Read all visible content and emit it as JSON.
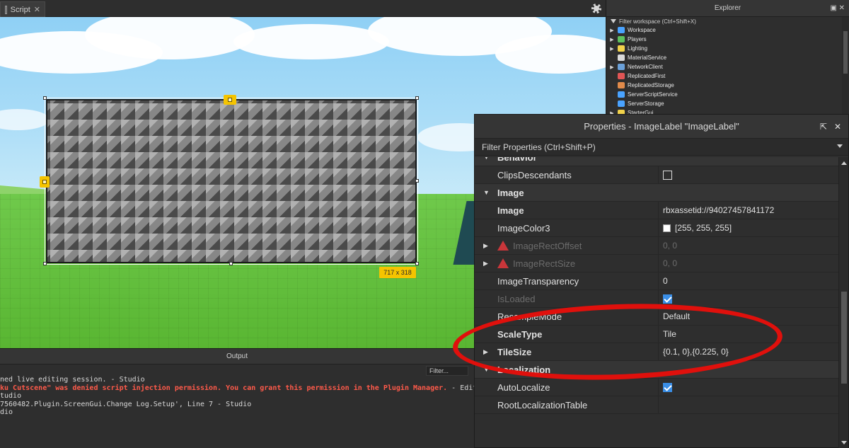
{
  "tabs": [
    {
      "label": "Script",
      "close": "✕"
    }
  ],
  "viewport": {
    "size_label": "717 x 318"
  },
  "explorer": {
    "title": "Explorer",
    "filter_placeholder": "Filter workspace (Ctrl+Shift+X)",
    "items": [
      {
        "label": "Workspace",
        "expandable": true,
        "icon_color": "#4aa3ff",
        "icon": "workspace-icon"
      },
      {
        "label": "Players",
        "expandable": true,
        "icon_color": "#5ec15e",
        "icon": "players-icon"
      },
      {
        "label": "Lighting",
        "expandable": true,
        "icon_color": "#f1d24b",
        "icon": "lighting-icon"
      },
      {
        "label": "MaterialService",
        "expandable": false,
        "icon_color": "#d9d9d9",
        "icon": "material-service-icon"
      },
      {
        "label": "NetworkClient",
        "expandable": true,
        "icon_color": "#6aa0d8",
        "icon": "network-client-icon"
      },
      {
        "label": "ReplicatedFirst",
        "expandable": false,
        "icon_color": "#e05555",
        "icon": "replicated-first-icon"
      },
      {
        "label": "ReplicatedStorage",
        "expandable": false,
        "icon_color": "#e08a4a",
        "icon": "replicated-storage-icon"
      },
      {
        "label": "ServerScriptService",
        "expandable": false,
        "icon_color": "#4aa3ff",
        "icon": "server-script-service-icon"
      },
      {
        "label": "ServerStorage",
        "expandable": false,
        "icon_color": "#4aa3ff",
        "icon": "server-storage-icon"
      },
      {
        "label": "StarterGui",
        "expandable": true,
        "icon_color": "#f1d24b",
        "icon": "starter-gui-icon"
      }
    ]
  },
  "output": {
    "title": "Output",
    "filter_label": "Filter...",
    "lines": [
      {
        "text": "ned live editing session.  -  Studio",
        "error": false,
        "suffix": ""
      },
      {
        "text": "ku Cutscene\" was denied script injection permission. You can grant this permission in the Plugin Manager.",
        "error": true,
        "suffix": "  -  Edit"
      },
      {
        "text": "tudio",
        "error": false,
        "suffix": ""
      },
      {
        "text": "7560482.Plugin.ScreenGui.Change Log.Setup', Line 7  -  Studio",
        "error": false,
        "suffix": ""
      },
      {
        "text": "dio",
        "error": false,
        "suffix": ""
      }
    ]
  },
  "properties": {
    "title": "Properties - ImageLabel \"ImageLabel\"",
    "filter_placeholder": "Filter Properties (Ctrl+Shift+P)",
    "rows": [
      {
        "kind": "category",
        "name": "Behavior",
        "expanded": true
      },
      {
        "kind": "prop",
        "name": "ClipsDescendants",
        "value_type": "checkbox",
        "checked": false
      },
      {
        "kind": "category",
        "name": "Image",
        "expanded": true
      },
      {
        "kind": "prop",
        "name": "Image",
        "bold": true,
        "value": "rbxassetid://94027457841172"
      },
      {
        "kind": "prop",
        "name": "ImageColor3",
        "value_type": "color",
        "swatch": "#ffffff",
        "value": "[255, 255, 255]"
      },
      {
        "kind": "prop",
        "name": "ImageRectOffset",
        "disabled": true,
        "warning": true,
        "expandable": true,
        "value": "0, 0"
      },
      {
        "kind": "prop",
        "name": "ImageRectSize",
        "disabled": true,
        "warning": true,
        "expandable": true,
        "value": "0, 0"
      },
      {
        "kind": "prop",
        "name": "ImageTransparency",
        "value": "0"
      },
      {
        "kind": "prop",
        "name": "IsLoaded",
        "disabled": true,
        "value_type": "checkbox",
        "checked": true
      },
      {
        "kind": "prop",
        "name": "ResampleMode",
        "value": "Default"
      },
      {
        "kind": "prop",
        "name": "ScaleType",
        "bold": true,
        "value": "Tile"
      },
      {
        "kind": "prop",
        "name": "TileSize",
        "bold": true,
        "expandable": true,
        "value": "{0.1, 0},{0.225, 0}"
      },
      {
        "kind": "category",
        "name": "Localization",
        "expanded": true
      },
      {
        "kind": "prop",
        "name": "AutoLocalize",
        "value_type": "checkbox",
        "checked": true
      },
      {
        "kind": "prop",
        "name": "RootLocalizationTable",
        "value": ""
      }
    ]
  },
  "colors": {
    "accent": "#f5c400",
    "annotation": "#e0100c",
    "checkbox_on": "#3a8ee6",
    "error_text": "#ff5a4a"
  }
}
